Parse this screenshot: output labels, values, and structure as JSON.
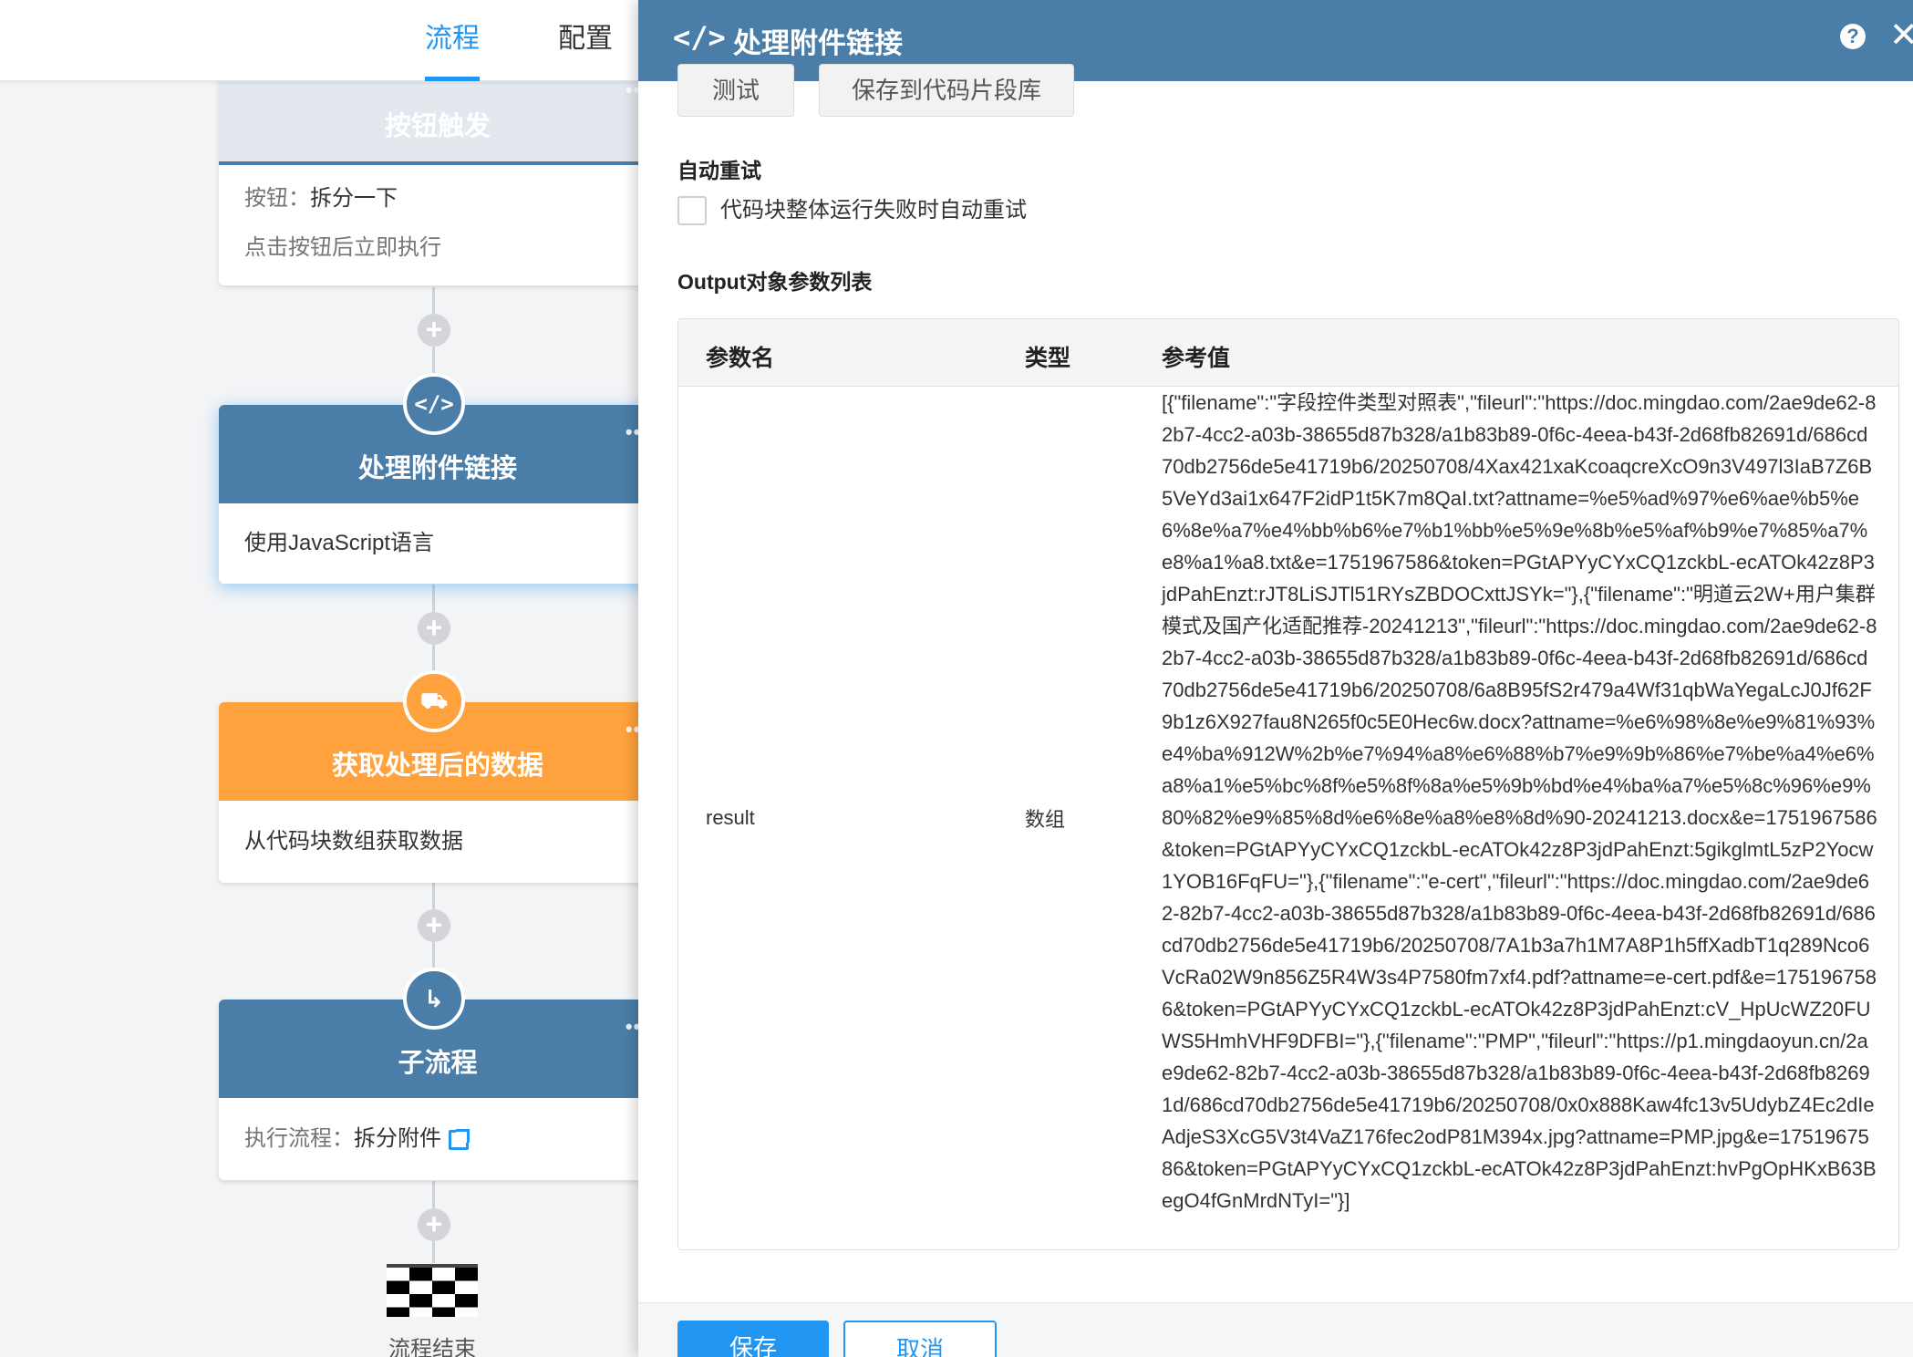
{
  "tabs": {
    "flow": "流程",
    "config": "配置"
  },
  "nodes": {
    "trigger": {
      "title": "按钮触发",
      "line1_label": "按钮：",
      "line1_value": "拆分一下",
      "line2": "点击按钮后立即执行",
      "color": "#4a7ea8"
    },
    "code": {
      "title": "处理附件链接",
      "desc": "使用JavaScript语言",
      "color": "#4a7ea8"
    },
    "fetch": {
      "title": "获取处理后的数据",
      "desc": "从代码块数组获取数据",
      "color": "#ffa13c"
    },
    "subflow": {
      "title": "子流程",
      "label": "执行流程：",
      "value": "拆分附件",
      "color": "#4a7ea8"
    },
    "end": {
      "label": "流程结束"
    }
  },
  "drawer": {
    "title": "处理附件链接",
    "test_button": "测试",
    "save_snippet_button": "保存到代码片段库",
    "auto_retry_label": "自动重试",
    "auto_retry_checkbox": "代码块整体运行失败时自动重试",
    "output_label": "Output对象参数列表",
    "table": {
      "columns": [
        "参数名",
        "类型",
        "参考值"
      ],
      "rows": [
        {
          "name": "result",
          "type": "数组",
          "value": "[{\"filename\":\"字段控件类型对照表\",\"fileurl\":\"https://doc.mingdao.com/2ae9de62-82b7-4cc2-a03b-38655d87b328/a1b83b89-0f6c-4eea-b43f-2d68fb82691d/686cd70db2756de5e41719b6/20250708/4Xax421xaKcoaqcreXcO9n3V497l3IaB7Z6B5VeYd3ai1x647F2idP1t5K7m8QaI.txt?attname=%e5%ad%97%e6%ae%b5%e6%8e%a7%e4%bb%b6%e7%b1%bb%e5%9e%8b%e5%af%b9%e7%85%a7%e8%a1%a8.txt&e=1751967586&token=PGtAPYyCYxCQ1zckbL-ecATOk42z8P3jdPahEnzt:rJT8LiSJTl51RYsZBDOCxttJSYk=\"},{\"filename\":\"明道云2W+用户集群模式及国产化适配推荐-20241213\",\"fileurl\":\"https://doc.mingdao.com/2ae9de62-82b7-4cc2-a03b-38655d87b328/a1b83b89-0f6c-4eea-b43f-2d68fb82691d/686cd70db2756de5e41719b6/20250708/6a8B95fS2r479a4Wf31qbWaYegaLcJ0Jf62F9b1z6X927fau8N265f0c5E0Hec6w.docx?attname=%e6%98%8e%e9%81%93%e4%ba%912W%2b%e7%94%a8%e6%88%b7%e9%9b%86%e7%be%a4%e6%a8%a1%e5%bc%8f%e5%8f%8a%e5%9b%bd%e4%ba%a7%e5%8c%96%e9%80%82%e9%85%8d%e6%8e%a8%e8%8d%90-20241213.docx&e=1751967586&token=PGtAPYyCYxCQ1zckbL-ecATOk42z8P3jdPahEnzt:5gikglmtL5zP2Yocw1YOB16FqFU=\"},{\"filename\":\"e-cert\",\"fileurl\":\"https://doc.mingdao.com/2ae9de62-82b7-4cc2-a03b-38655d87b328/a1b83b89-0f6c-4eea-b43f-2d68fb82691d/686cd70db2756de5e41719b6/20250708/7A1b3a7h1M7A8P1h5ffXadbT1q289Nco6VcRa02W9n856Z5R4W3s4P7580fm7xf4.pdf?attname=e-cert.pdf&e=1751967586&token=PGtAPYyCYxCQ1zckbL-ecATOk42z8P3jdPahEnzt:cV_HpUcWZ20FUWS5HmhVHF9DFBI=\"},{\"filename\":\"PMP\",\"fileurl\":\"https://p1.mingdaoyun.cn/2ae9de62-82b7-4cc2-a03b-38655d87b328/a1b83b89-0f6c-4eea-b43f-2d68fb82691d/686cd70db2756de5e41719b6/20250708/0x0x888Kaw4fc13v5UdybZ4Ec2dIeAdjeS3XcG5V3t4VaZ176fec2odP81M394x.jpg?attname=PMP.jpg&e=1751967586&token=PGtAPYyCYxCQ1zckbL-ecATOk42z8P3jdPahEnzt:hvPgOpHKxB63BegO4fGnMrdNTyI=\"}]"
        }
      ]
    },
    "save_button": "保存",
    "cancel_button": "取消",
    "header_color": "#4a7ea8",
    "primary_color": "#2196f3"
  }
}
